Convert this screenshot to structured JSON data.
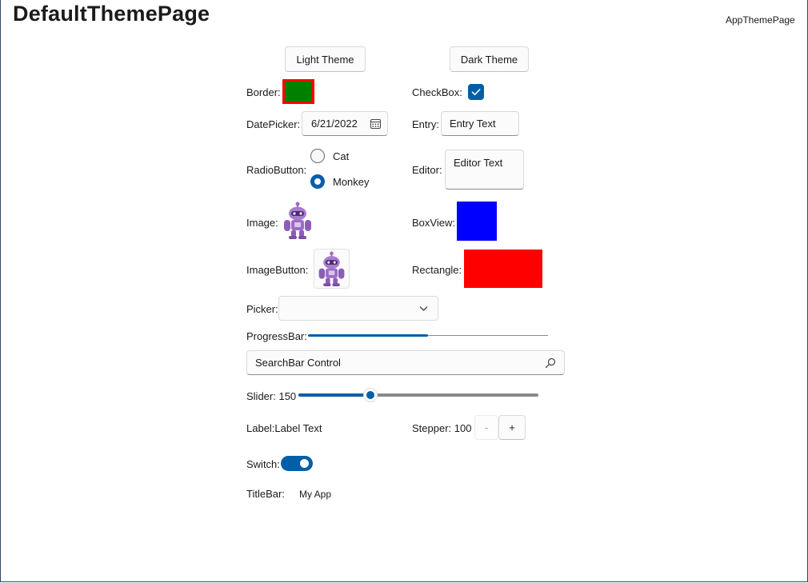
{
  "window": {
    "title": "DefaultThemePage",
    "nav_link": "AppThemePage"
  },
  "theme_buttons": {
    "light": "Light Theme",
    "dark": "Dark Theme"
  },
  "labels": {
    "border": "Border:",
    "checkbox": "CheckBox:",
    "datepicker": "DatePicker:",
    "entry": "Entry:",
    "radiobutton": "RadioButton:",
    "editor": "Editor:",
    "image": "Image:",
    "boxview": "BoxView:",
    "imagebutton": "ImageButton:",
    "rectangle": "Rectangle:",
    "picker": "Picker:",
    "progressbar": "ProgressBar:",
    "slider": "Slider: 150",
    "label": "Label:Label Text",
    "stepper": "Stepper: 100",
    "switch": "Switch:",
    "titlebar": "TitleBar:"
  },
  "datepicker": {
    "value": "6/21/2022"
  },
  "entry": {
    "value": "Entry Text"
  },
  "editor": {
    "value": "Editor Text"
  },
  "radio": {
    "options": [
      "Cat",
      "Monkey"
    ],
    "selected": "Monkey"
  },
  "checkbox": {
    "checked": true
  },
  "picker": {
    "selected": ""
  },
  "progress": {
    "value": 0.5
  },
  "searchbar": {
    "value": "SearchBar Control"
  },
  "slider": {
    "value": 150,
    "min": 0,
    "max": 500
  },
  "stepper": {
    "value": 100,
    "minus": "-",
    "plus": "+"
  },
  "switch": {
    "on": true
  },
  "titlebar": {
    "title": "My App"
  },
  "colors": {
    "accent": "#005fa8",
    "border_fill": "#008000",
    "border_stroke": "#ff0000",
    "boxview": "#0000ff",
    "rectangle": "#ff0000",
    "robot": "#9d6cc3"
  },
  "icons": {
    "datepicker": "calendar-icon",
    "picker": "chevron-down-icon",
    "search": "search-icon",
    "checkbox": "checkmark-icon",
    "image": "dotnet-bot-image"
  }
}
